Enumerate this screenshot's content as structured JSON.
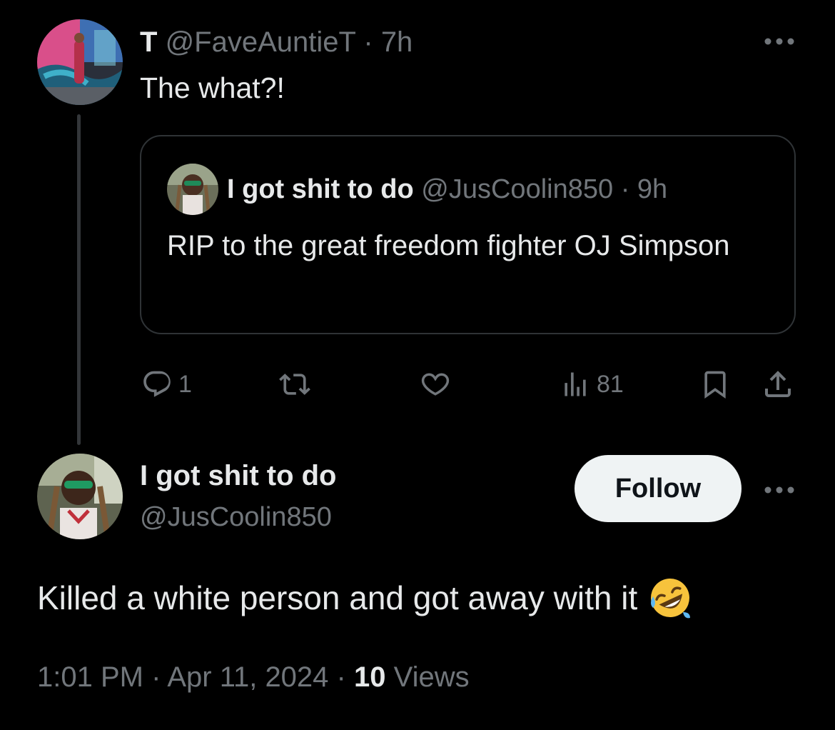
{
  "colors": {
    "background": "#000000",
    "text_primary": "#e7e9ea",
    "text_secondary": "#71767b",
    "border": "#2f3336",
    "follow_button_bg": "#eff3f4",
    "follow_button_text": "#0f1419"
  },
  "parent_tweet": {
    "display_name": "T",
    "handle": "@FaveAuntieT",
    "separator": "·",
    "time": "7h",
    "text": "The what?!",
    "more_icon": "more-horizontal-icon",
    "quoted_tweet": {
      "display_name": "I got shit to do",
      "handle": "@JusCoolin850",
      "separator": "·",
      "time": "9h",
      "text": "RIP to the great freedom fighter OJ Simpson"
    },
    "actions": {
      "reply": {
        "icon": "reply-icon",
        "count": "1"
      },
      "retweet": {
        "icon": "retweet-icon",
        "count": ""
      },
      "like": {
        "icon": "heart-icon",
        "count": ""
      },
      "views": {
        "icon": "views-icon",
        "count": "81"
      },
      "bookmark": {
        "icon": "bookmark-icon"
      },
      "share": {
        "icon": "share-icon"
      }
    }
  },
  "main_tweet": {
    "display_name": "I got shit to do",
    "handle": "@JusCoolin850",
    "follow_label": "Follow",
    "more_icon": "more-horizontal-icon",
    "text": "Killed a white person and got away with it",
    "emoji": "rolling-on-floor-laughing-emoji",
    "timestamp": "1:01 PM",
    "date": "Apr 11, 2024",
    "separator": "·",
    "views_count": "10",
    "views_label": "Views"
  }
}
